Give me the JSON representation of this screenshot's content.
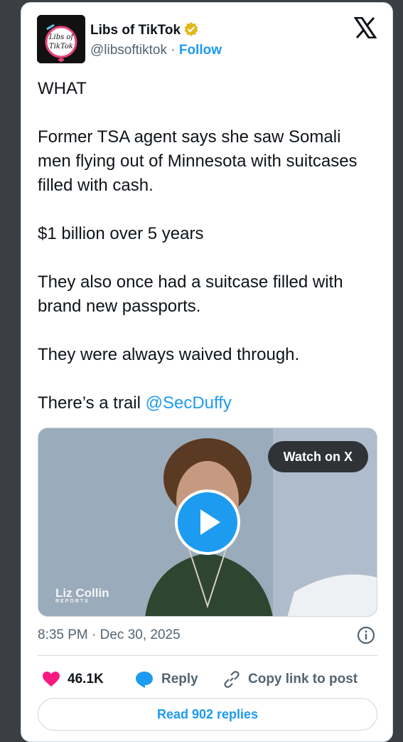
{
  "author": {
    "name": "Libs of TikTok",
    "handle": "@libsoftiktok",
    "separator": "·",
    "follow_label": "Follow",
    "avatar_text_line1": "Libs of",
    "avatar_text_line2": "TikTok"
  },
  "tweet": {
    "line_what": "WHAT",
    "line_1": "Former TSA agent says she saw Somali men flying out of Minnesota with suitcases filled with cash.",
    "line_2": "$1 billion over 5 years",
    "line_3": "They also once had a suitcase filled with brand new passports.",
    "line_4": "They were always waived through.",
    "line_5_prefix": "There’s a trail ",
    "mention": "@SecDuffy"
  },
  "media": {
    "watch_label": "Watch on X",
    "watermark": "Liz Collin",
    "watermark_sub": "REPORTS"
  },
  "meta": {
    "timestamp": "8:35 PM · Dec 30, 2025"
  },
  "actions": {
    "likes": "46.1K",
    "reply": "Reply",
    "copy_link": "Copy link to post",
    "read_replies": "Read 902 replies"
  },
  "colors": {
    "accent": "#1d9bf0",
    "like": "#f91880",
    "text": "#0f1419",
    "muted": "#536471"
  }
}
